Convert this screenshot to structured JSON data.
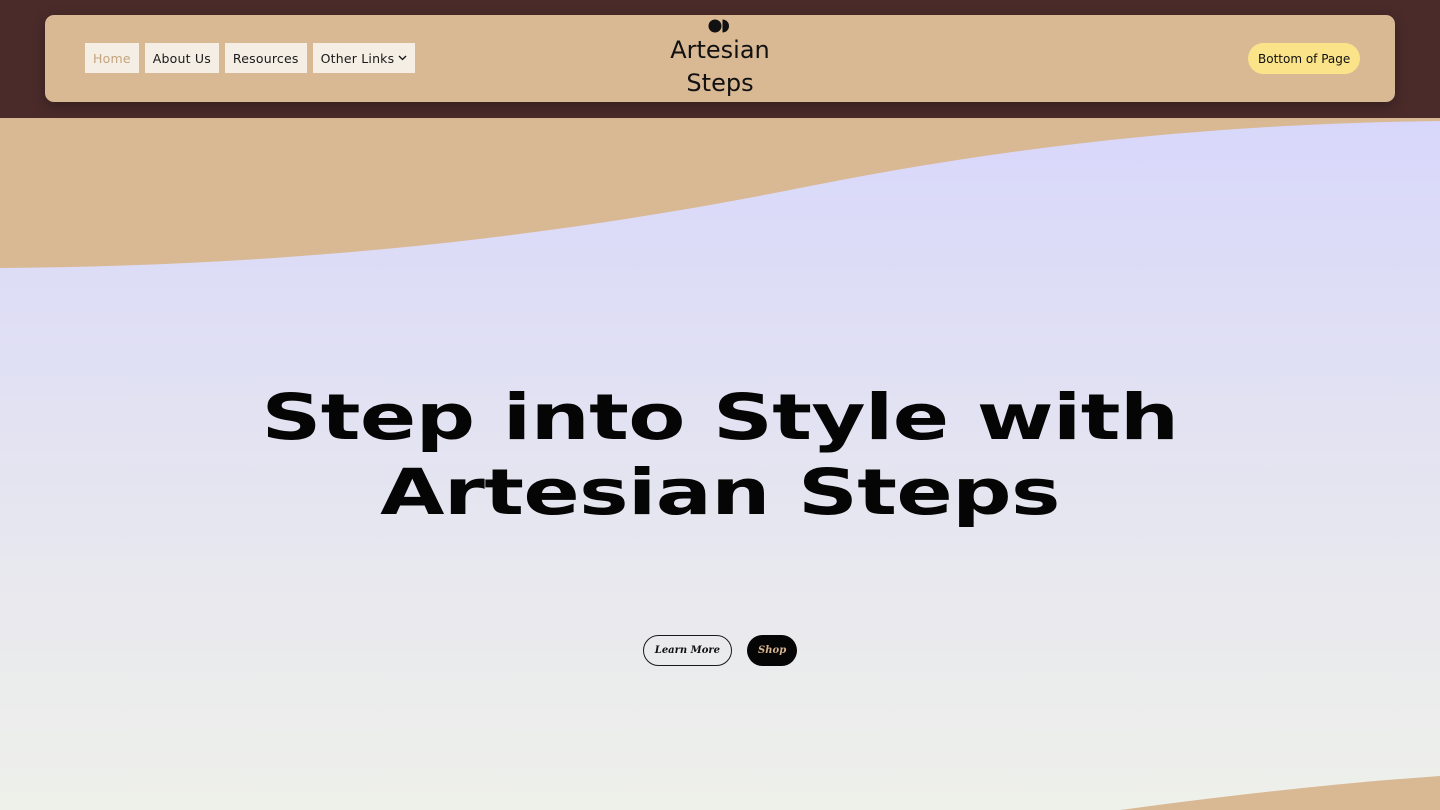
{
  "nav": {
    "links": [
      {
        "label": "Home"
      },
      {
        "label": "About Us"
      },
      {
        "label": "Resources"
      },
      {
        "label": "Other Links"
      }
    ],
    "brand": {
      "line1": "Artesian",
      "line2": "Steps"
    },
    "cta_label": "Bottom of Page"
  },
  "hero": {
    "title": "Step into Style with Artesian Steps",
    "learn_more_label": "Learn More",
    "shop_label": "Shop"
  },
  "colors": {
    "top_band": "#4a2b2a",
    "nav_bg": "#d9b894",
    "nav_item_bg": "#f4eee4",
    "active_link": "#c4a57e",
    "cta_yellow": "#fbe38a",
    "hero_top": "#d8d7fb",
    "hero_bottom": "#eef0ea"
  },
  "icons": {
    "logo": "brand-logo-icon",
    "dropdown": "chevron-down-icon"
  }
}
